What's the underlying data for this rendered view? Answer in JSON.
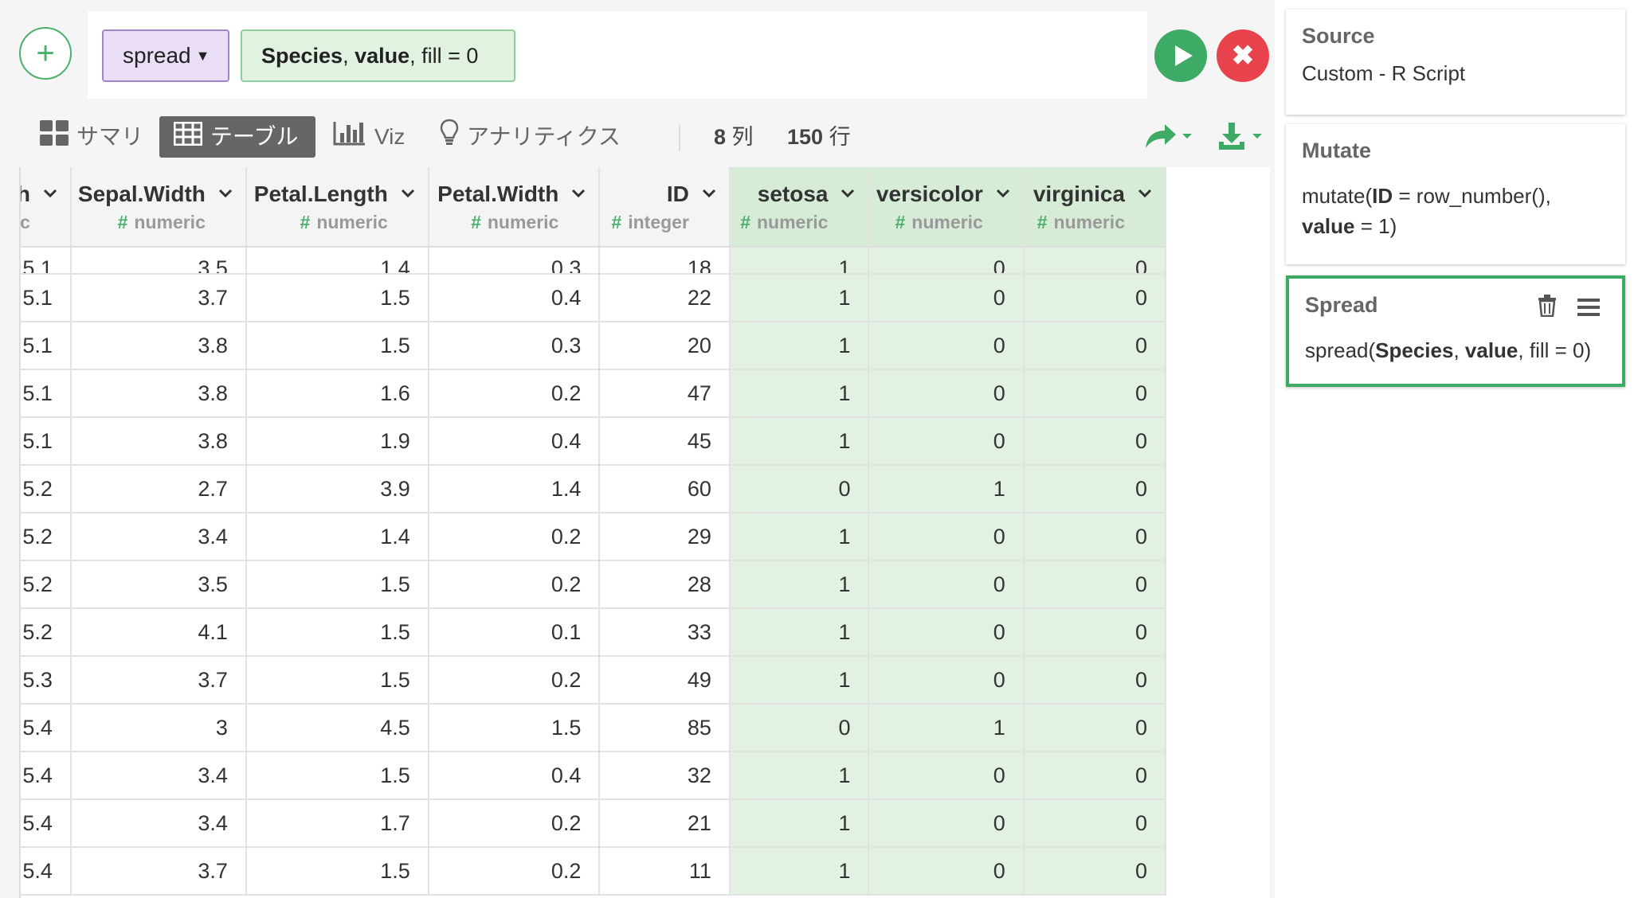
{
  "command": {
    "function": "spread",
    "args_bold_1": "Species",
    "args_sep_1": ", ",
    "args_bold_2": "value",
    "args_rest": ", fill = 0"
  },
  "tabs": [
    {
      "label": "サマリ",
      "icon": "summary-grid-icon"
    },
    {
      "label": "テーブル",
      "icon": "table-icon",
      "active": true
    },
    {
      "label": "Viz",
      "icon": "bar-chart-icon"
    },
    {
      "label": "アナリティクス",
      "icon": "lightbulb-icon"
    }
  ],
  "counts": {
    "cols_num": "8",
    "cols_unit": "列",
    "rows_num": "150",
    "rows_unit": "行"
  },
  "columns": [
    {
      "name": "Sepal.Length",
      "type": "numeric"
    },
    {
      "name": "Sepal.Width",
      "type": "numeric"
    },
    {
      "name": "Petal.Length",
      "type": "numeric"
    },
    {
      "name": "Petal.Width",
      "type": "numeric"
    },
    {
      "name": "ID",
      "type": "integer"
    },
    {
      "name": "setosa",
      "type": "numeric"
    },
    {
      "name": "versicolor",
      "type": "numeric"
    },
    {
      "name": "virginica",
      "type": "numeric"
    }
  ],
  "rows": [
    [
      "5.1",
      "3.5",
      "1.4",
      "0.3",
      "18",
      "1",
      "0",
      "0"
    ],
    [
      "5.1",
      "3.7",
      "1.5",
      "0.4",
      "22",
      "1",
      "0",
      "0"
    ],
    [
      "5.1",
      "3.8",
      "1.5",
      "0.3",
      "20",
      "1",
      "0",
      "0"
    ],
    [
      "5.1",
      "3.8",
      "1.6",
      "0.2",
      "47",
      "1",
      "0",
      "0"
    ],
    [
      "5.1",
      "3.8",
      "1.9",
      "0.4",
      "45",
      "1",
      "0",
      "0"
    ],
    [
      "5.2",
      "2.7",
      "3.9",
      "1.4",
      "60",
      "0",
      "1",
      "0"
    ],
    [
      "5.2",
      "3.4",
      "1.4",
      "0.2",
      "29",
      "1",
      "0",
      "0"
    ],
    [
      "5.2",
      "3.5",
      "1.5",
      "0.2",
      "28",
      "1",
      "0",
      "0"
    ],
    [
      "5.2",
      "4.1",
      "1.5",
      "0.1",
      "33",
      "1",
      "0",
      "0"
    ],
    [
      "5.3",
      "3.7",
      "1.5",
      "0.2",
      "49",
      "1",
      "0",
      "0"
    ],
    [
      "5.4",
      "3",
      "4.5",
      "1.5",
      "85",
      "0",
      "1",
      "0"
    ],
    [
      "5.4",
      "3.4",
      "1.5",
      "0.4",
      "32",
      "1",
      "0",
      "0"
    ],
    [
      "5.4",
      "3.4",
      "1.7",
      "0.2",
      "21",
      "1",
      "0",
      "0"
    ],
    [
      "5.4",
      "3.7",
      "1.5",
      "0.2",
      "11",
      "1",
      "0",
      "0"
    ]
  ],
  "steps": {
    "source": {
      "title": "Source",
      "body": "Custom - R Script"
    },
    "mutate": {
      "title": "Mutate",
      "code_1": "mutate(",
      "bold_1": "ID",
      "code_2": " = row_number(),",
      "bold_2": "value",
      "code_3": " = 1)"
    },
    "spread": {
      "title": "Spread",
      "code_1": "spread(",
      "bold_1": "Species",
      "code_2": ", ",
      "bold_2": "value",
      "code_3": ", fill = 0)"
    }
  },
  "colors": {
    "accent_green": "#3daa66",
    "highlight_col": "#e2f1e2",
    "cancel_red": "#e8424d",
    "command_purple": "#eadff7"
  }
}
